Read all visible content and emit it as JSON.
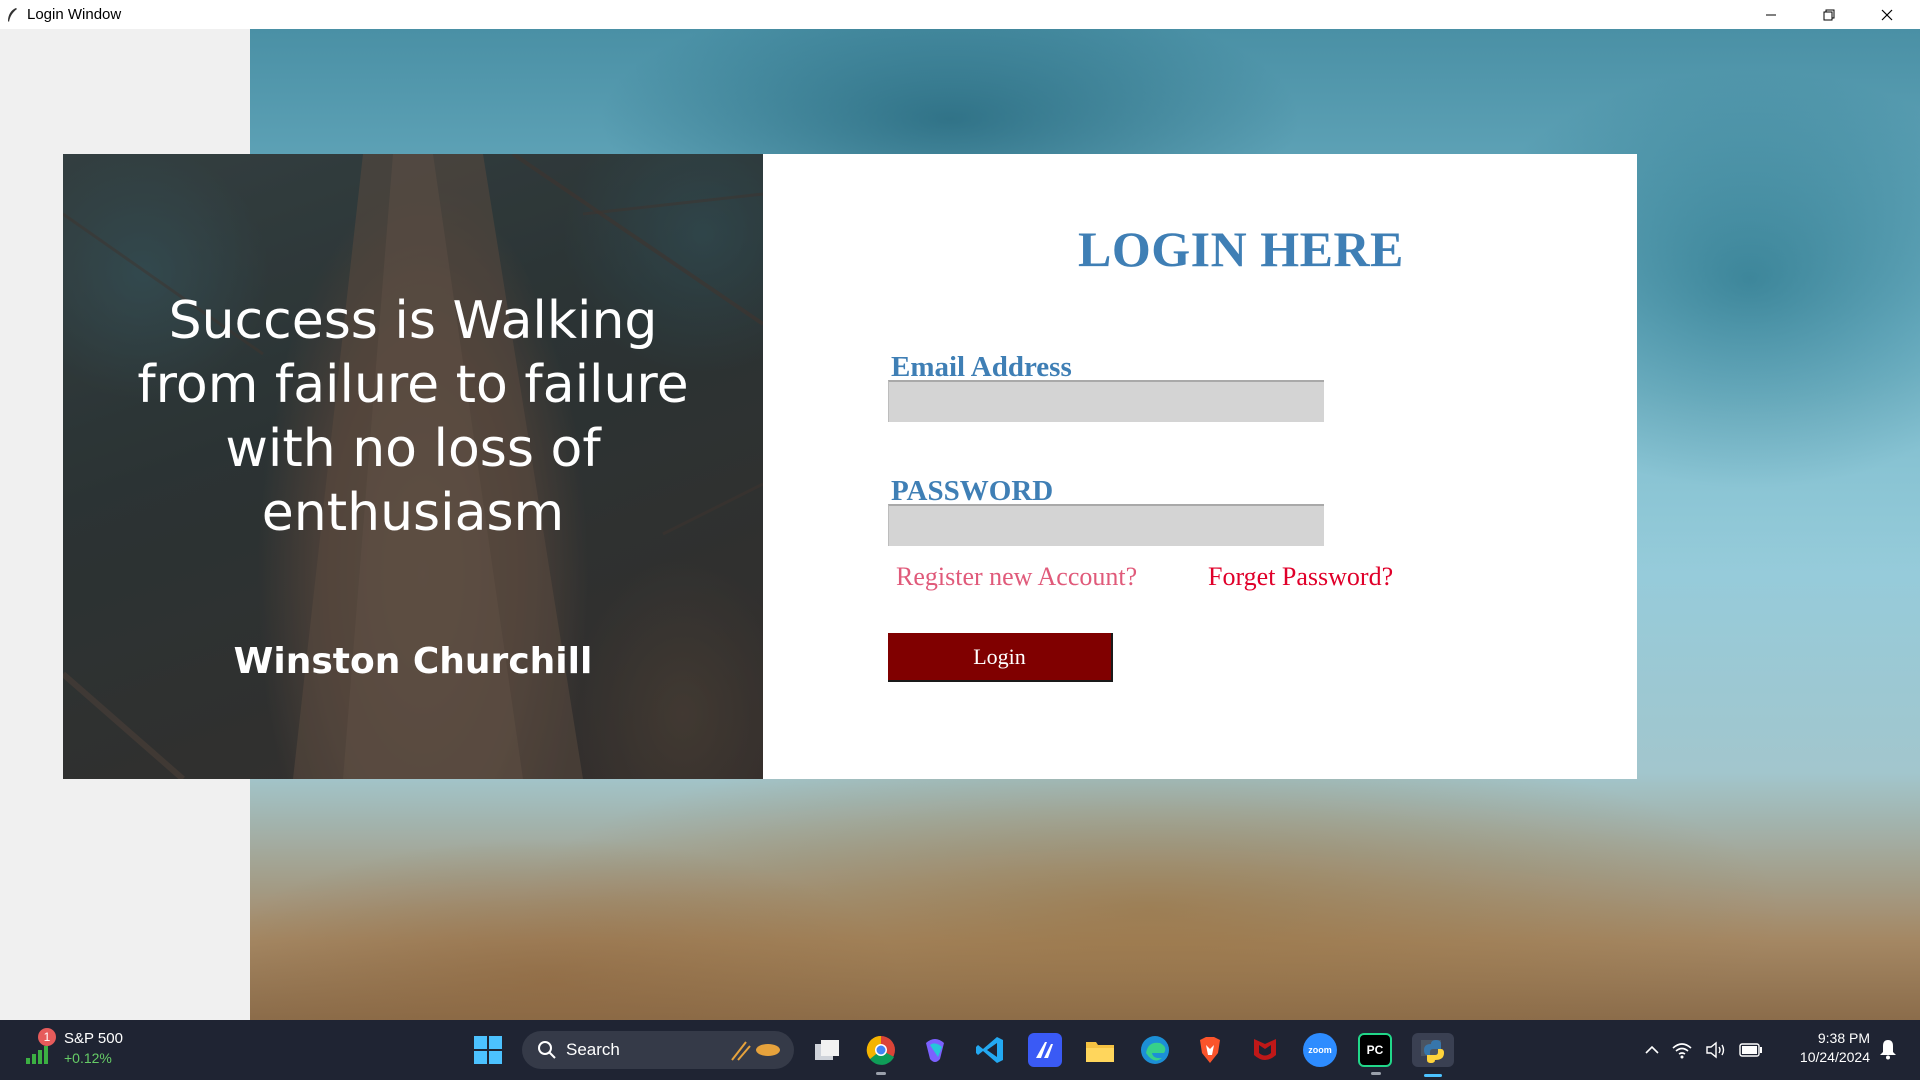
{
  "window": {
    "title": "Login Window"
  },
  "quote": {
    "text_lines": [
      "Success is Walking",
      "from failure to failure",
      "with no loss of",
      "enthusiasm"
    ],
    "author": "Winston Churchill"
  },
  "login": {
    "heading": "LOGIN HERE",
    "email_label": "Email Address",
    "email_value": "",
    "password_label": "PASSWORD",
    "password_value": "",
    "register_link": "Register new Account?",
    "forgot_link": "Forget Password?",
    "login_button": "Login",
    "colors": {
      "heading": "#3f7fb5",
      "register_link": "#e05a7a",
      "forgot_link": "#e0002a",
      "button_bg": "#800000"
    }
  },
  "taskbar": {
    "stock": {
      "name": "S&P 500",
      "change": "+0.12%",
      "badge": "1"
    },
    "search_label": "Search",
    "apps": [
      "file-explorer-icon",
      "chrome-icon",
      "copilot-icon",
      "vscode-icon",
      "app-icon",
      "folder-icon",
      "edge-icon",
      "brave-icon",
      "mcafee-icon",
      "zoom-icon",
      "pycharm-icon",
      "python-icon"
    ],
    "clock": {
      "time": "9:38 PM",
      "date": "10/24/2024"
    }
  }
}
